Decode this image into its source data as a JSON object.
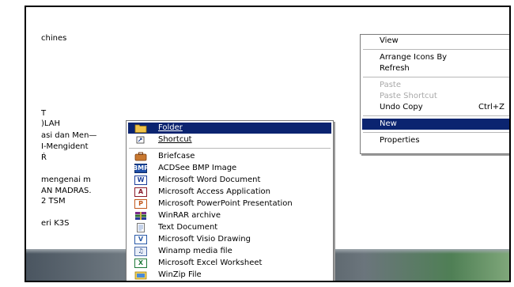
{
  "background_labels": [
    "chines",
    "T",
    ")LAH",
    "asi dan Men—",
    "I-Mengident",
    "Ŕ",
    "mengenai m",
    "AN MADRAS.",
    "2 TSM",
    "eri K3S"
  ],
  "context_menu": {
    "view": "View",
    "arrange": "Arrange Icons By",
    "refresh": "Refresh",
    "paste": "Paste",
    "paste_shortcut": "Paste Shortcut",
    "undo_copy": "Undo Copy",
    "undo_shortcut": "Ctrl+Z",
    "new": "New",
    "properties": "Properties"
  },
  "new_submenu": {
    "folder": {
      "label": "Folder",
      "icon": "folder-icon"
    },
    "shortcut": {
      "label": "Shortcut",
      "icon": "shortcut-icon"
    },
    "items": [
      {
        "label": "Briefcase",
        "icon": "briefcase-icon"
      },
      {
        "label": "ACDSee BMP Image",
        "icon": "acdsee-bmp-icon"
      },
      {
        "label": "Microsoft Word Document",
        "icon": "word-icon"
      },
      {
        "label": "Microsoft Access Application",
        "icon": "access-icon"
      },
      {
        "label": "Microsoft PowerPoint Presentation",
        "icon": "powerpoint-icon"
      },
      {
        "label": "WinRAR archive",
        "icon": "winrar-icon"
      },
      {
        "label": "Text Document",
        "icon": "text-document-icon"
      },
      {
        "label": "Microsoft Visio Drawing",
        "icon": "visio-icon"
      },
      {
        "label": "Winamp media file",
        "icon": "winamp-icon"
      },
      {
        "label": "Microsoft Excel Worksheet",
        "icon": "excel-icon"
      },
      {
        "label": "WinZip File",
        "icon": "winzip-icon"
      }
    ]
  },
  "colors": {
    "selection": "#0b2470",
    "disabled": "#a8a8a8"
  }
}
